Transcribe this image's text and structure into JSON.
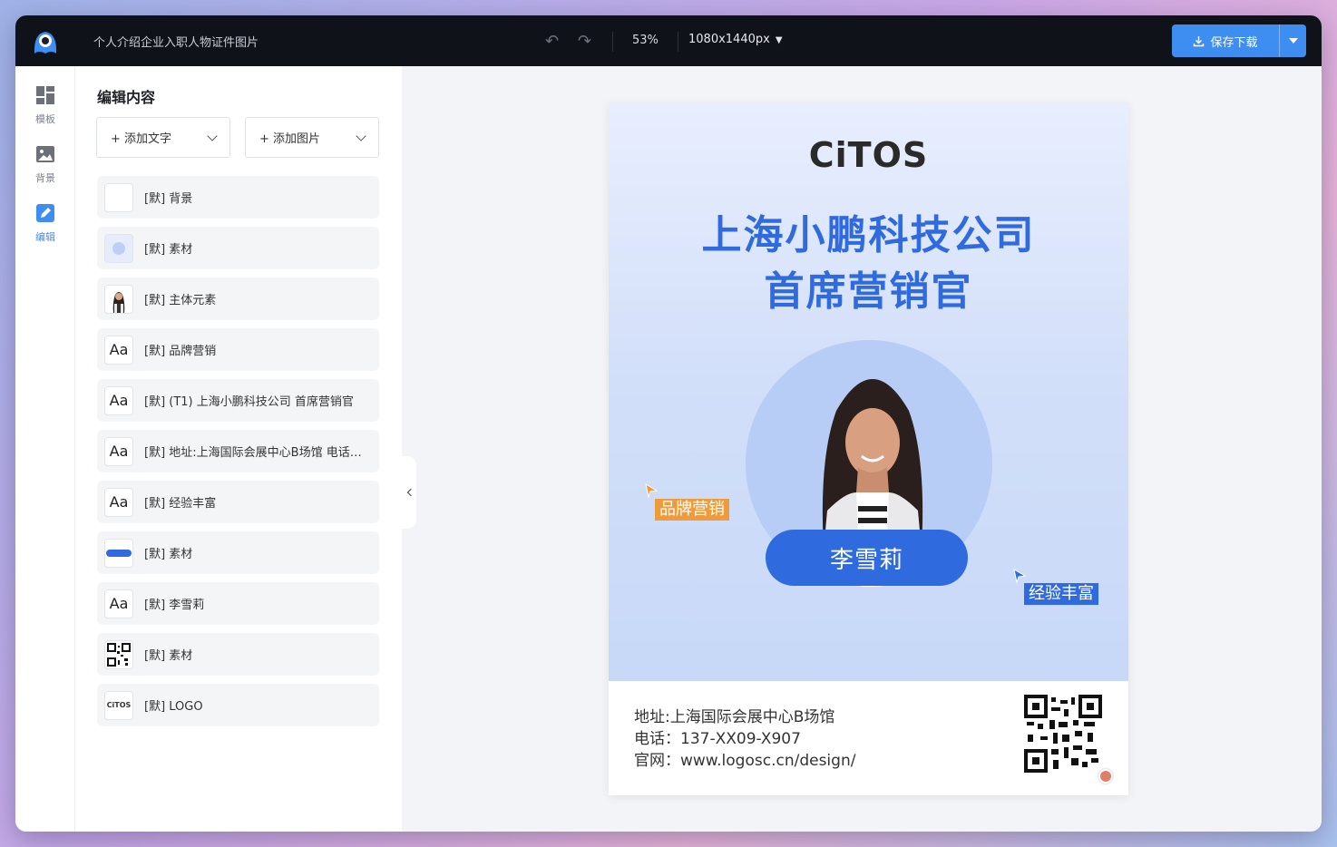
{
  "app": {
    "doc_title": "个人介绍企业入职人物证件图片",
    "zoom": "53%",
    "canvas_size": "1080x1440px",
    "save_label": "保存下载"
  },
  "rail": [
    {
      "label": "模板",
      "icon": "template-grid-icon"
    },
    {
      "label": "背景",
      "icon": "image-icon"
    },
    {
      "label": "编辑",
      "icon": "pencil-icon"
    }
  ],
  "panel": {
    "title": "编辑内容",
    "add_text": "+ 添加文字",
    "add_image": "+ 添加图片",
    "layers": [
      {
        "label": "[默] 背景",
        "thumb": "blank"
      },
      {
        "label": "[默] 素材",
        "thumb": "circle"
      },
      {
        "label": "[默] 主体元素",
        "thumb": "person"
      },
      {
        "label": "[默] 品牌营销",
        "thumb": "Aa"
      },
      {
        "label": "[默] (T1) 上海小鹏科技公司 首席营销官",
        "thumb": "Aa"
      },
      {
        "label": "[默] 地址:上海国际会展中心B场馆 电话：137-XX09-X907 官网：www.logosc.cn/design/",
        "thumb": "Aa"
      },
      {
        "label": "[默] 经验丰富",
        "thumb": "Aa"
      },
      {
        "label": "[默] 素材",
        "thumb": "bar"
      },
      {
        "label": "[默] 李雪莉",
        "thumb": "Aa"
      },
      {
        "label": "[默] 素材",
        "thumb": "qr"
      },
      {
        "label": "[默] LOGO",
        "thumb": "logo"
      }
    ]
  },
  "card": {
    "brand": "CiTOS",
    "headline_1": "上海小鹏科技公司",
    "headline_2": "首席营销官",
    "tag_left": "品牌营销",
    "tag_right": "经验丰富",
    "name": "李雪莉",
    "address": "地址:上海国际会展中心B场馆",
    "phone": "电话：137-XX09-X907",
    "website": "官网：www.logosc.cn/design/",
    "colors": {
      "primary": "#2f6bde",
      "tag_orange": "#ef9b3b"
    }
  }
}
